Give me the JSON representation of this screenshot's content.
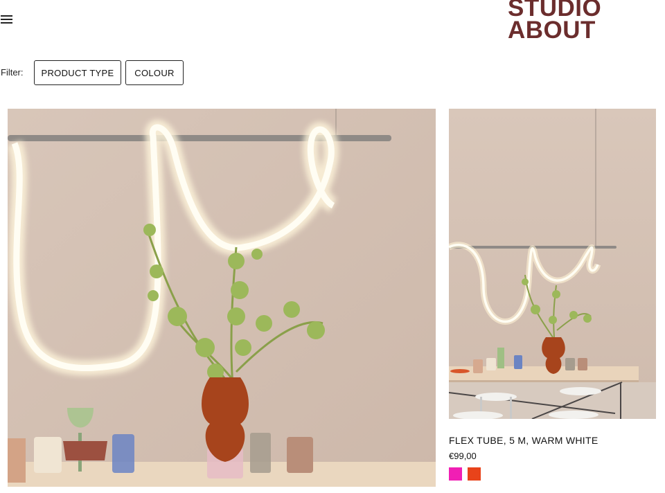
{
  "header": {
    "menu_icon": "hamburger-menu-icon",
    "logo_line1": "STUDIO",
    "logo_line2": "ABOUT",
    "logo_color": "#6b2d2d"
  },
  "filters": {
    "label": "Filter:",
    "product_type": "PRODUCT TYPE",
    "colour": "COLOUR"
  },
  "products": [
    {
      "image": "neon-flex-tube-lifestyle-photo"
    },
    {
      "image": "neon-flex-tube-dining-table-photo",
      "title": "FLEX TUBE, 5 M, WARM WHITE",
      "price": "€99,00",
      "swatches": [
        "#f01fb4",
        "#e8431a"
      ]
    }
  ]
}
